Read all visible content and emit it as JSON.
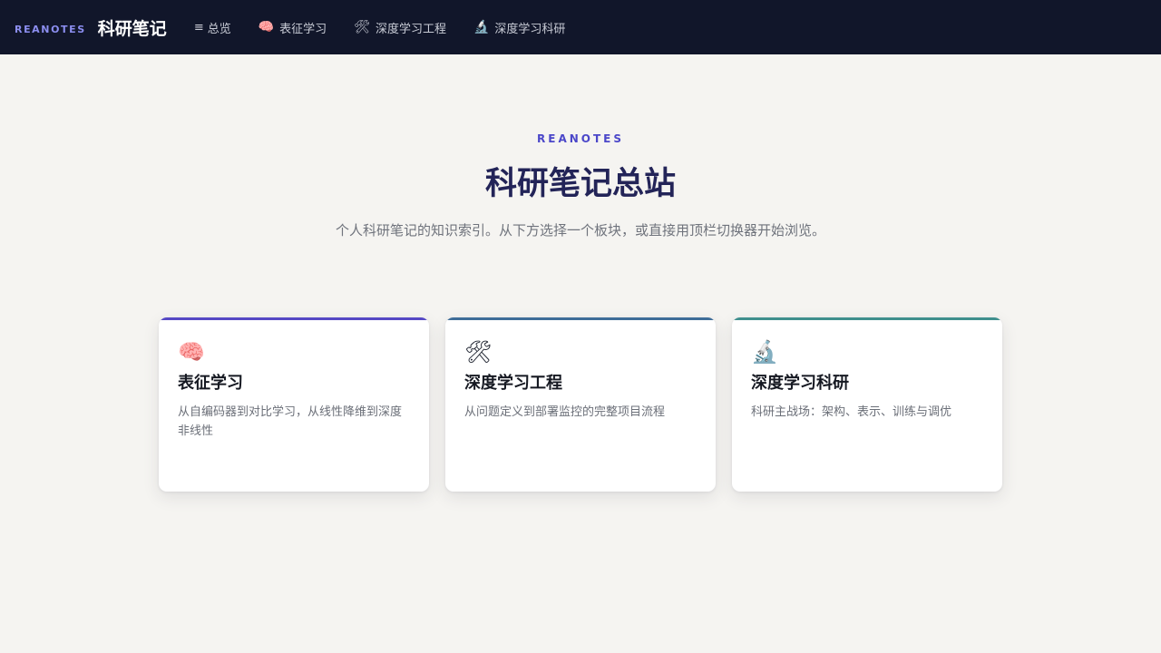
{
  "topbar": {
    "brand_tag": "REANOTES",
    "brand_title": "科研笔记",
    "nav": [
      {
        "icon": "≡",
        "icon_name": "menu-icon",
        "label": "总览"
      },
      {
        "icon": "🧠",
        "icon_name": "brain-icon",
        "label": "表征学习"
      },
      {
        "icon": "🛠",
        "icon_name": "tools-icon",
        "label": "深度学习工程"
      },
      {
        "icon": "🔬",
        "icon_name": "microscope-icon",
        "label": "深度学习科研"
      }
    ]
  },
  "hero": {
    "eyebrow": "REANOTES",
    "title": "科研笔记总站",
    "subtitle": "个人科研笔记的知识索引。从下方选择一个板块，或直接用顶栏切换器开始浏览。"
  },
  "cards": [
    {
      "icon": "🧠",
      "icon_name": "brain-icon",
      "title": "表征学习",
      "desc": "从自编码器到对比学习，从线性降维到深度非线性",
      "accent": "#5548c4"
    },
    {
      "icon": "🛠",
      "icon_name": "tools-icon",
      "title": "深度学习工程",
      "desc": "从问题定义到部署监控的完整项目流程",
      "accent": "#3e6d98"
    },
    {
      "icon": "🔬",
      "icon_name": "microscope-icon",
      "title": "深度学习科研",
      "desc": "科研主战场：架构、表示、训练与调优",
      "accent": "#3f8f8d"
    }
  ],
  "colors": {
    "topbar_bg": "#11162a",
    "page_bg": "#f5f4f1",
    "accent": "#4b47c9",
    "title": "#232458"
  }
}
